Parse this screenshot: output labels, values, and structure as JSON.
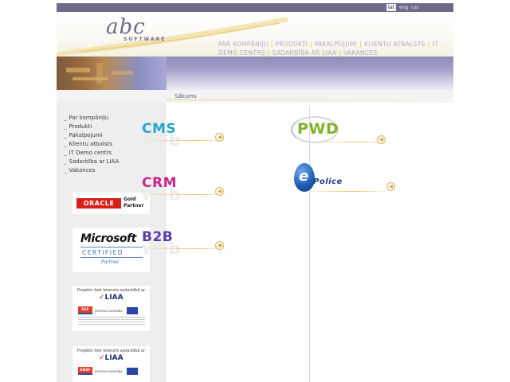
{
  "languages": [
    {
      "label": "lat",
      "active": true
    },
    {
      "label": "eng",
      "active": false
    },
    {
      "label": "rus",
      "active": false
    }
  ],
  "logo": {
    "main": "abc",
    "sub": "SOFTWARE"
  },
  "topnav": {
    "items": [
      "PAR KOMPĀNIJU",
      "PRODUKTI",
      "PAKALPOJUMI",
      "KLIENTU ATBALSTS",
      "IT DEMO CENTRS",
      "SADARBĪBA AR LIAA",
      "VAKANCES"
    ]
  },
  "breadcrumb": "Sākums",
  "sidebar": {
    "items": [
      "Par kompāniju",
      "Produkti",
      "Pakalpojumi",
      "Klientu atbalsts",
      "IT Demo centrs",
      "Sadarbība ar LIAA",
      "Vakances"
    ],
    "dash": "_"
  },
  "badges": {
    "oracle": {
      "logo": "ORACLE",
      "level": "Gold",
      "type": "Partner"
    },
    "microsoft": {
      "name": "Microsoft",
      "certified": "CERTIFIED",
      "type": "Partner"
    },
    "liaa1": {
      "header": "Projekts tiek īstenots sadarbībā ar",
      "logo": "LIAA",
      "fund": "ESF",
      "eu_text": "EIROPAS SAVIENĪBA"
    },
    "liaa2": {
      "header": "Projekts tiek īstenots sadarbībā ar",
      "logo": "LIAA",
      "fund": "ERAF",
      "eu_text": "EIROPAS SAVIENĪBA"
    }
  },
  "products": {
    "cms": {
      "name": "CMS",
      "ghost": "web"
    },
    "crm": {
      "name": "CRM",
      "ghost": "web"
    },
    "b2b": {
      "name": "B2B",
      "ghost": "web"
    },
    "pwd": {
      "name": "PWD"
    },
    "epolice": {
      "letter": "e",
      "name": "Police"
    }
  },
  "arrow_glyph": "◀",
  "colors": {
    "topbar": "#6d6a8e",
    "cms": "#27a6c8",
    "crm": "#c8278c",
    "b2b": "#5a3da0",
    "pwd": "#7fb22c",
    "epolice": "#1c3e8a"
  }
}
